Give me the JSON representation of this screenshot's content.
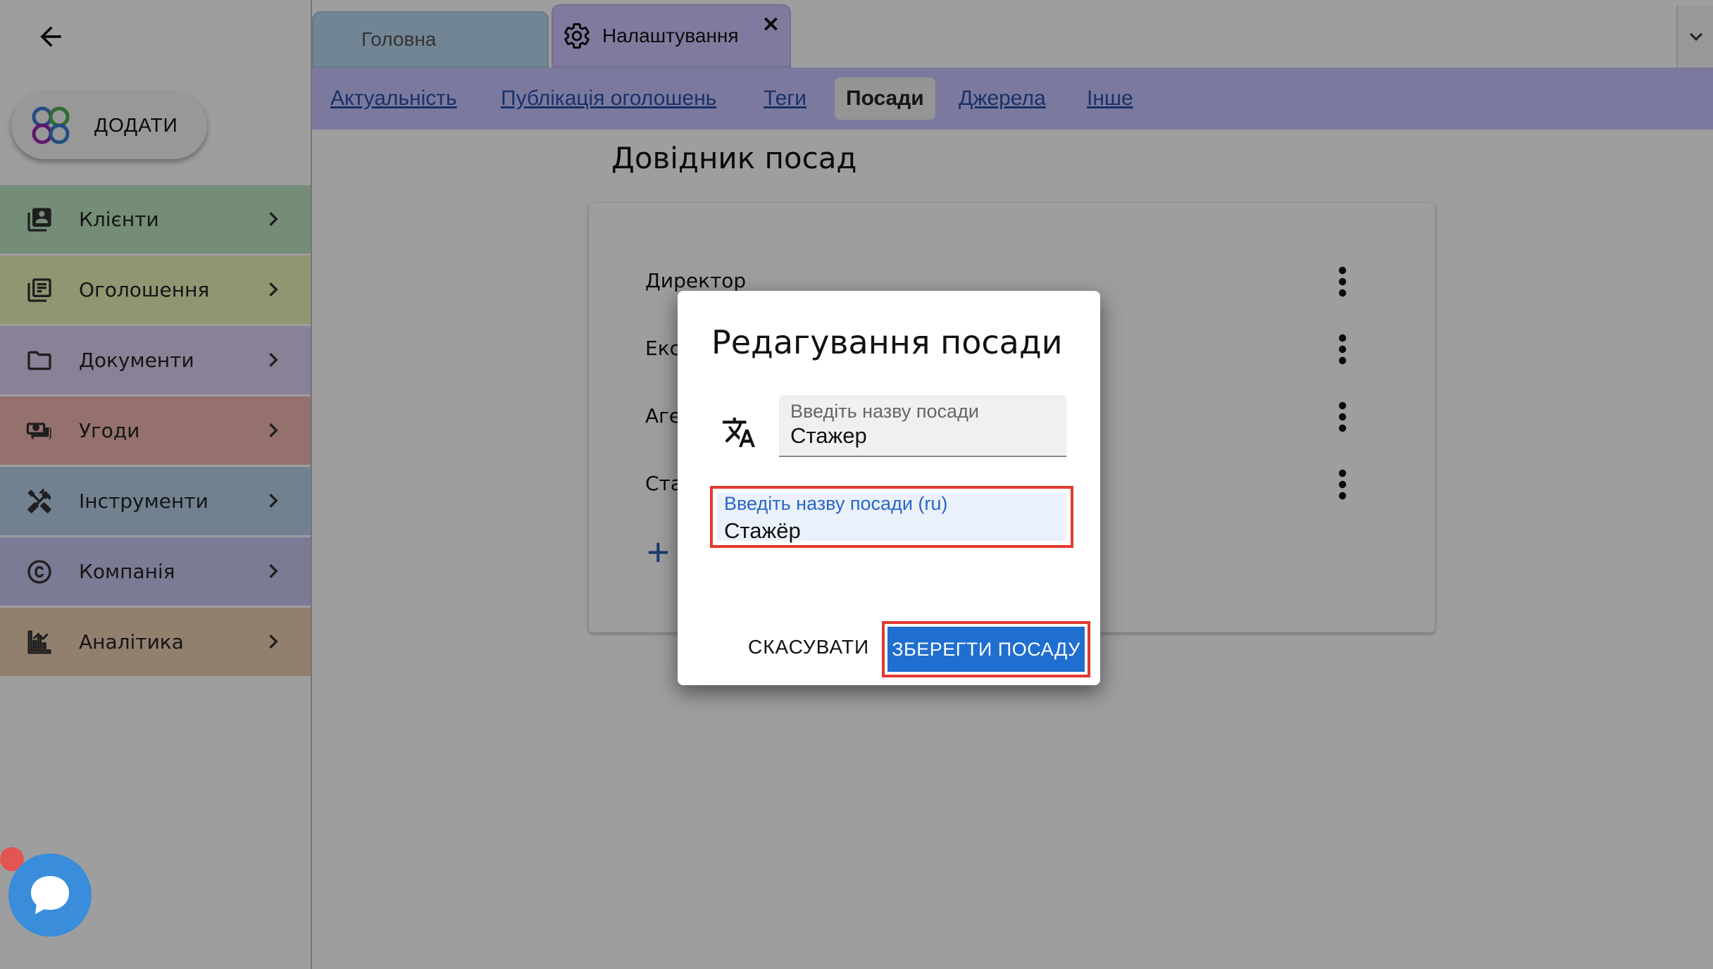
{
  "sidebar": {
    "add_label": "ДОДАТИ",
    "items": [
      {
        "label": "Клієнти",
        "icon": "contacts-icon",
        "color": "#bde3c0"
      },
      {
        "label": "Оголошення",
        "icon": "listings-icon",
        "color": "#ebf1b6"
      },
      {
        "label": "Документи",
        "icon": "folder-icon",
        "color": "#ddd0f0"
      },
      {
        "label": "Угоди",
        "icon": "cash-icon",
        "color": "#f0b7b2"
      },
      {
        "label": "Інструменти",
        "icon": "tools-icon",
        "color": "#b7d1e9"
      },
      {
        "label": "Компанія",
        "icon": "copyright-icon",
        "color": "#c9c7f0"
      },
      {
        "label": "Аналітика",
        "icon": "analytics-icon",
        "color": "#eccfb4"
      }
    ]
  },
  "tabs": {
    "home": "Головна",
    "settings": "Налаштування",
    "close": "✕"
  },
  "subnav": {
    "items": [
      "Актуальність",
      "Публікація оголошень",
      "Теги",
      "Посади",
      "Джерела",
      "Інше"
    ]
  },
  "content": {
    "title": "Довідник посад",
    "positions": [
      "Директор",
      "Екс",
      "Аге",
      "Ста"
    ],
    "add_symbol": "+"
  },
  "dialog": {
    "title": "Редагування посади",
    "field_ua": {
      "label": "Введіть назву посади",
      "value": "Стажер"
    },
    "field_ru": {
      "label": "Введіть назву посади (ru)",
      "value": "Стажёр"
    },
    "cancel": "СКАСУВАТИ",
    "save": "ЗБЕРЕГТИ ПОСАДУ"
  },
  "colors": {
    "accent": "#1f6fd1",
    "highlight": "#e23a2f",
    "subnav_bg": "#c7c5ff"
  }
}
